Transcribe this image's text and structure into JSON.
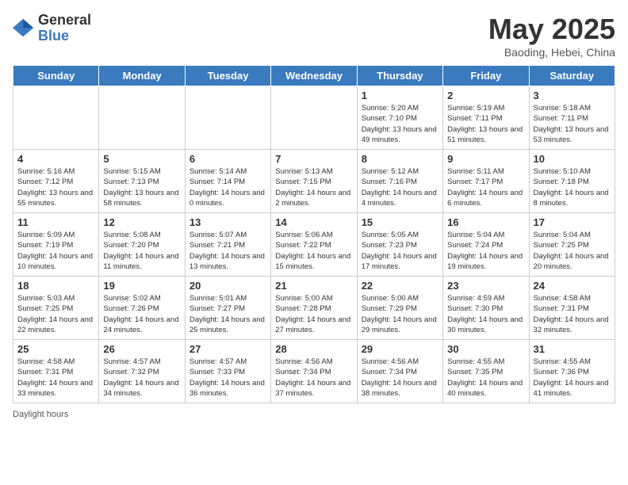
{
  "logo": {
    "general": "General",
    "blue": "Blue"
  },
  "title": "May 2025",
  "subtitle": "Baoding, Hebei, China",
  "days_of_week": [
    "Sunday",
    "Monday",
    "Tuesday",
    "Wednesday",
    "Thursday",
    "Friday",
    "Saturday"
  ],
  "footer": "Daylight hours",
  "weeks": [
    [
      {
        "day": "",
        "sunrise": "",
        "sunset": "",
        "daylight": ""
      },
      {
        "day": "",
        "sunrise": "",
        "sunset": "",
        "daylight": ""
      },
      {
        "day": "",
        "sunrise": "",
        "sunset": "",
        "daylight": ""
      },
      {
        "day": "",
        "sunrise": "",
        "sunset": "",
        "daylight": ""
      },
      {
        "day": "1",
        "sunrise": "Sunrise: 5:20 AM",
        "sunset": "Sunset: 7:10 PM",
        "daylight": "Daylight: 13 hours and 49 minutes."
      },
      {
        "day": "2",
        "sunrise": "Sunrise: 5:19 AM",
        "sunset": "Sunset: 7:11 PM",
        "daylight": "Daylight: 13 hours and 51 minutes."
      },
      {
        "day": "3",
        "sunrise": "Sunrise: 5:18 AM",
        "sunset": "Sunset: 7:11 PM",
        "daylight": "Daylight: 13 hours and 53 minutes."
      }
    ],
    [
      {
        "day": "4",
        "sunrise": "Sunrise: 5:16 AM",
        "sunset": "Sunset: 7:12 PM",
        "daylight": "Daylight: 13 hours and 55 minutes."
      },
      {
        "day": "5",
        "sunrise": "Sunrise: 5:15 AM",
        "sunset": "Sunset: 7:13 PM",
        "daylight": "Daylight: 13 hours and 58 minutes."
      },
      {
        "day": "6",
        "sunrise": "Sunrise: 5:14 AM",
        "sunset": "Sunset: 7:14 PM",
        "daylight": "Daylight: 14 hours and 0 minutes."
      },
      {
        "day": "7",
        "sunrise": "Sunrise: 5:13 AM",
        "sunset": "Sunset: 7:15 PM",
        "daylight": "Daylight: 14 hours and 2 minutes."
      },
      {
        "day": "8",
        "sunrise": "Sunrise: 5:12 AM",
        "sunset": "Sunset: 7:16 PM",
        "daylight": "Daylight: 14 hours and 4 minutes."
      },
      {
        "day": "9",
        "sunrise": "Sunrise: 5:11 AM",
        "sunset": "Sunset: 7:17 PM",
        "daylight": "Daylight: 14 hours and 6 minutes."
      },
      {
        "day": "10",
        "sunrise": "Sunrise: 5:10 AM",
        "sunset": "Sunset: 7:18 PM",
        "daylight": "Daylight: 14 hours and 8 minutes."
      }
    ],
    [
      {
        "day": "11",
        "sunrise": "Sunrise: 5:09 AM",
        "sunset": "Sunset: 7:19 PM",
        "daylight": "Daylight: 14 hours and 10 minutes."
      },
      {
        "day": "12",
        "sunrise": "Sunrise: 5:08 AM",
        "sunset": "Sunset: 7:20 PM",
        "daylight": "Daylight: 14 hours and 11 minutes."
      },
      {
        "day": "13",
        "sunrise": "Sunrise: 5:07 AM",
        "sunset": "Sunset: 7:21 PM",
        "daylight": "Daylight: 14 hours and 13 minutes."
      },
      {
        "day": "14",
        "sunrise": "Sunrise: 5:06 AM",
        "sunset": "Sunset: 7:22 PM",
        "daylight": "Daylight: 14 hours and 15 minutes."
      },
      {
        "day": "15",
        "sunrise": "Sunrise: 5:05 AM",
        "sunset": "Sunset: 7:23 PM",
        "daylight": "Daylight: 14 hours and 17 minutes."
      },
      {
        "day": "16",
        "sunrise": "Sunrise: 5:04 AM",
        "sunset": "Sunset: 7:24 PM",
        "daylight": "Daylight: 14 hours and 19 minutes."
      },
      {
        "day": "17",
        "sunrise": "Sunrise: 5:04 AM",
        "sunset": "Sunset: 7:25 PM",
        "daylight": "Daylight: 14 hours and 20 minutes."
      }
    ],
    [
      {
        "day": "18",
        "sunrise": "Sunrise: 5:03 AM",
        "sunset": "Sunset: 7:25 PM",
        "daylight": "Daylight: 14 hours and 22 minutes."
      },
      {
        "day": "19",
        "sunrise": "Sunrise: 5:02 AM",
        "sunset": "Sunset: 7:26 PM",
        "daylight": "Daylight: 14 hours and 24 minutes."
      },
      {
        "day": "20",
        "sunrise": "Sunrise: 5:01 AM",
        "sunset": "Sunset: 7:27 PM",
        "daylight": "Daylight: 14 hours and 25 minutes."
      },
      {
        "day": "21",
        "sunrise": "Sunrise: 5:00 AM",
        "sunset": "Sunset: 7:28 PM",
        "daylight": "Daylight: 14 hours and 27 minutes."
      },
      {
        "day": "22",
        "sunrise": "Sunrise: 5:00 AM",
        "sunset": "Sunset: 7:29 PM",
        "daylight": "Daylight: 14 hours and 29 minutes."
      },
      {
        "day": "23",
        "sunrise": "Sunrise: 4:59 AM",
        "sunset": "Sunset: 7:30 PM",
        "daylight": "Daylight: 14 hours and 30 minutes."
      },
      {
        "day": "24",
        "sunrise": "Sunrise: 4:58 AM",
        "sunset": "Sunset: 7:31 PM",
        "daylight": "Daylight: 14 hours and 32 minutes."
      }
    ],
    [
      {
        "day": "25",
        "sunrise": "Sunrise: 4:58 AM",
        "sunset": "Sunset: 7:31 PM",
        "daylight": "Daylight: 14 hours and 33 minutes."
      },
      {
        "day": "26",
        "sunrise": "Sunrise: 4:57 AM",
        "sunset": "Sunset: 7:32 PM",
        "daylight": "Daylight: 14 hours and 34 minutes."
      },
      {
        "day": "27",
        "sunrise": "Sunrise: 4:57 AM",
        "sunset": "Sunset: 7:33 PM",
        "daylight": "Daylight: 14 hours and 36 minutes."
      },
      {
        "day": "28",
        "sunrise": "Sunrise: 4:56 AM",
        "sunset": "Sunset: 7:34 PM",
        "daylight": "Daylight: 14 hours and 37 minutes."
      },
      {
        "day": "29",
        "sunrise": "Sunrise: 4:56 AM",
        "sunset": "Sunset: 7:34 PM",
        "daylight": "Daylight: 14 hours and 38 minutes."
      },
      {
        "day": "30",
        "sunrise": "Sunrise: 4:55 AM",
        "sunset": "Sunset: 7:35 PM",
        "daylight": "Daylight: 14 hours and 40 minutes."
      },
      {
        "day": "31",
        "sunrise": "Sunrise: 4:55 AM",
        "sunset": "Sunset: 7:36 PM",
        "daylight": "Daylight: 14 hours and 41 minutes."
      }
    ]
  ]
}
